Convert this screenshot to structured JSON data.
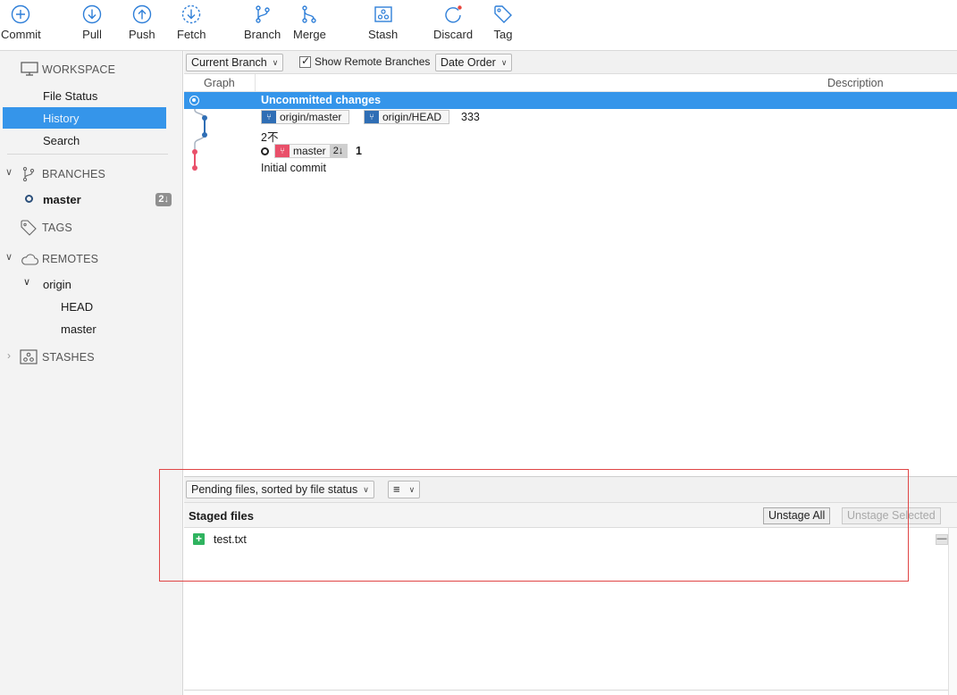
{
  "toolbar": {
    "buttons": [
      {
        "label": "Commit",
        "icon": "plus-circle-icon"
      },
      {
        "label": "Pull",
        "icon": "arrow-down-circle-icon"
      },
      {
        "label": "Push",
        "icon": "arrow-up-circle-icon"
      },
      {
        "label": "Fetch",
        "icon": "dashed-down-circle-icon"
      },
      {
        "label": "Branch",
        "icon": "branch-icon"
      },
      {
        "label": "Merge",
        "icon": "merge-icon"
      },
      {
        "label": "Stash",
        "icon": "stash-icon"
      },
      {
        "label": "Discard",
        "icon": "discard-icon"
      },
      {
        "label": "Tag",
        "icon": "tag-icon"
      }
    ]
  },
  "sidebar": {
    "workspace": "WORKSPACE",
    "file_status": "File Status",
    "history": "History",
    "search": "Search",
    "branches": "BRANCHES",
    "branch_master": "master",
    "branch_master_badge": "2↓",
    "tags": "TAGS",
    "remotes": "REMOTES",
    "remote_origin": "origin",
    "origin_head": "HEAD",
    "origin_master": "master",
    "stashes": "STASHES"
  },
  "filters": {
    "branch_select": "Current Branch",
    "show_remote_label": "Show Remote Branches",
    "show_remote_checked": true,
    "order_select": "Date Order"
  },
  "columns": {
    "graph": "Graph",
    "description": "Description"
  },
  "commits": [
    {
      "text": "Uncommitted changes"
    },
    {
      "tag1": "origin/master",
      "tag2": "origin/HEAD",
      "text": "333"
    },
    {
      "text": "2不"
    },
    {
      "tag": "master",
      "tag_badge": "2↓",
      "text": "1"
    },
    {
      "text": "Initial commit"
    }
  ],
  "pending": {
    "sort_select": "Pending files, sorted by file status",
    "view_icon": "list-icon",
    "staged_title": "Staged files",
    "unstage_all": "Unstage All",
    "unstage_selected": "Unstage Selected",
    "files": [
      {
        "name": "test.txt",
        "status": "added"
      }
    ]
  },
  "colors": {
    "accent": "#3595ea",
    "remote_branch": "#2f6eb5",
    "local_branch": "#e9506a",
    "added": "#2fb35f",
    "highlight": "#e04545"
  }
}
